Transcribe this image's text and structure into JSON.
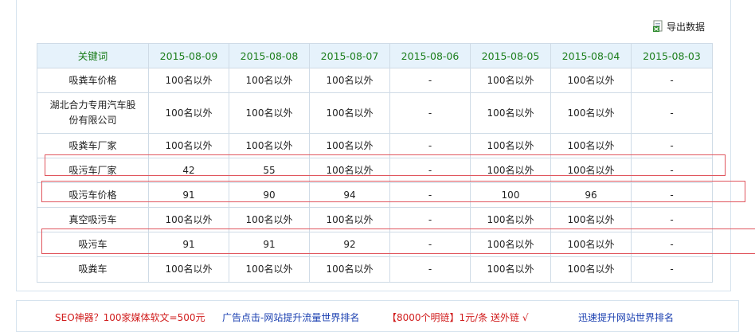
{
  "export": {
    "label": "导出数据",
    "icon": "excel-export-icon"
  },
  "table": {
    "columns": [
      "关键词",
      "2015-08-09",
      "2015-08-08",
      "2015-08-07",
      "2015-08-06",
      "2015-08-05",
      "2015-08-04",
      "2015-08-03"
    ],
    "rows": [
      {
        "keyword": "吸粪车价格",
        "values": [
          "100名以外",
          "100名以外",
          "100名以外",
          "-",
          "100名以外",
          "100名以外",
          "-"
        ]
      },
      {
        "keyword": "湖北合力专用汽车股份有限公司",
        "values": [
          "100名以外",
          "100名以外",
          "100名以外",
          "-",
          "100名以外",
          "100名以外",
          "-"
        ]
      },
      {
        "keyword": "吸粪车厂家",
        "values": [
          "100名以外",
          "100名以外",
          "100名以外",
          "-",
          "100名以外",
          "100名以外",
          "-"
        ]
      },
      {
        "keyword": "吸污车厂家",
        "values": [
          "42",
          "55",
          "100名以外",
          "-",
          "100名以外",
          "100名以外",
          "-"
        ]
      },
      {
        "keyword": "吸污车价格",
        "values": [
          "91",
          "90",
          "94",
          "-",
          "100",
          "96",
          "-"
        ]
      },
      {
        "keyword": "真空吸污车",
        "values": [
          "100名以外",
          "100名以外",
          "100名以外",
          "-",
          "100名以外",
          "100名以外",
          "-"
        ]
      },
      {
        "keyword": "吸污车",
        "values": [
          "91",
          "91",
          "92",
          "-",
          "100名以外",
          "100名以外",
          "-"
        ]
      },
      {
        "keyword": "吸粪车",
        "values": [
          "100名以外",
          "100名以外",
          "100名以外",
          "-",
          "100名以外",
          "100名以外",
          "-"
        ]
      }
    ]
  },
  "ads": [
    {
      "text": "SEO神器？100家媒体软文=500元",
      "color": "#d11d1d"
    },
    {
      "text": "广告点击-网站提升流量世界排名",
      "color": "#1a3fb0"
    },
    {
      "text": "【8000个明链】1元/条 送外链 √",
      "color": "#d11d1d"
    },
    {
      "text": "迅速提升网站世界排名",
      "color": "#1a3fb0"
    }
  ],
  "colors": {
    "header_bg": "#e6f2fb",
    "header_text": "#1a7d1a",
    "border": "#cfdbe6",
    "highlight": "#e0555d"
  }
}
